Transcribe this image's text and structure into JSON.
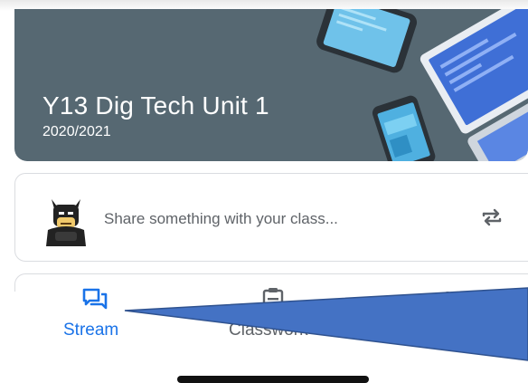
{
  "class": {
    "title": "Y13 Dig Tech Unit 1",
    "year": "2020/2021"
  },
  "share": {
    "placeholder": "Share something with your class...",
    "avatar_icon": "batman-avatar-icon",
    "repost_icon": "repost-icon"
  },
  "bottom_nav": {
    "items": [
      {
        "label": "Stream",
        "icon": "stream-icon",
        "active": true
      },
      {
        "label": "Classwork",
        "icon": "classwork-icon",
        "active": false
      },
      {
        "label": "",
        "icon": "people-icon",
        "active": false
      }
    ]
  },
  "colors": {
    "banner": "#566872",
    "accent": "#1a73e8",
    "annotation_arrow": "#4472c4"
  }
}
